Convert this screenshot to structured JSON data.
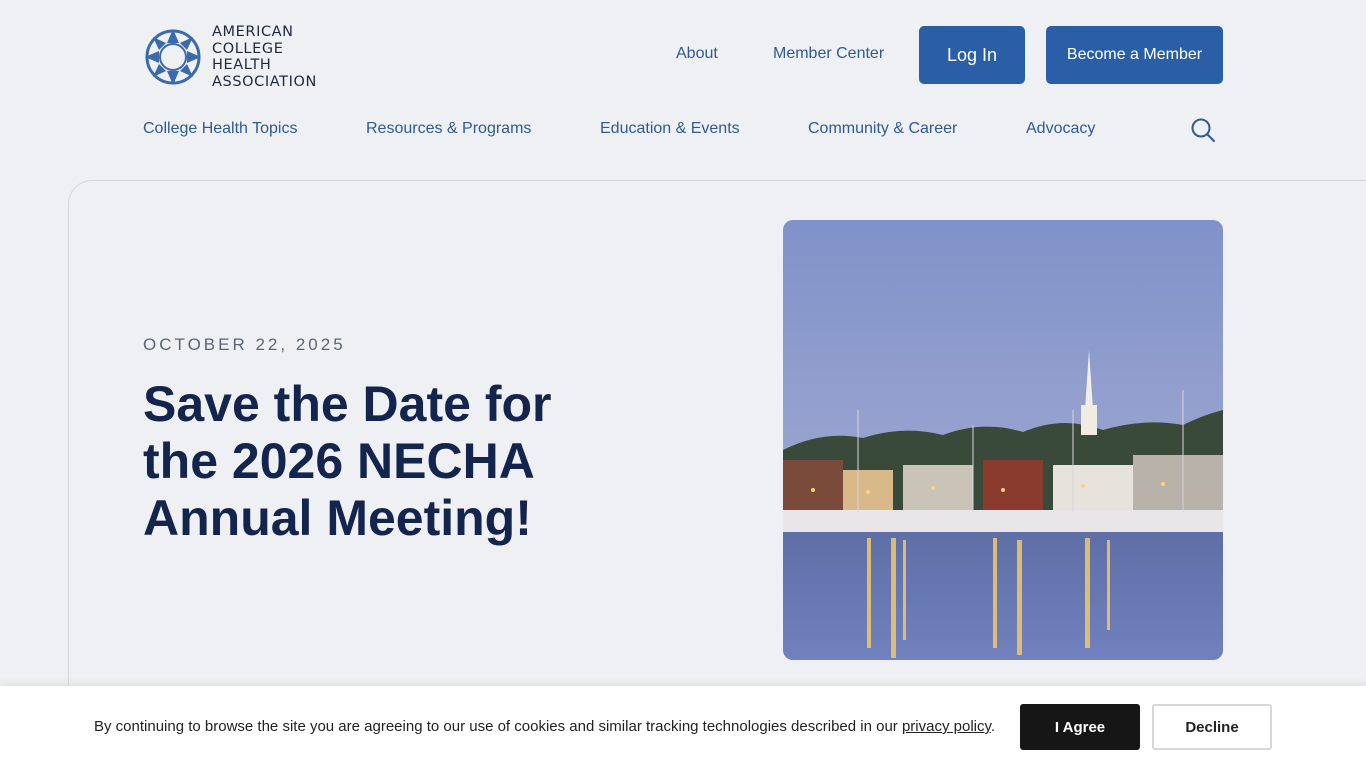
{
  "logo": {
    "lines": [
      "AMERICAN",
      "COLLEGE",
      "HEALTH",
      "ASSOCIATION"
    ],
    "icon": "acha-star-logo"
  },
  "top_nav": {
    "about": "About",
    "member_center": "Member Center",
    "login": "Log In",
    "become_member": "Become a Member"
  },
  "main_nav": [
    "College Health Topics",
    "Resources & Programs",
    "Education & Events",
    "Community & Career",
    "Advocacy"
  ],
  "search_icon": "search-icon",
  "article": {
    "date": "OCTOBER 22, 2025",
    "title": "Save the Date for the 2026 NECHA Annual Meeting!"
  },
  "cookie": {
    "text": "By continuing to browse the site you are agreeing to our use of cookies and similar tracking technologies described in our ",
    "link": "privacy policy",
    "suffix": ".",
    "agree": "I Agree",
    "decline": "Decline"
  },
  "colors": {
    "brand_blue": "#2a5fa7",
    "headline": "#14254d",
    "background": "#eef0f3"
  }
}
